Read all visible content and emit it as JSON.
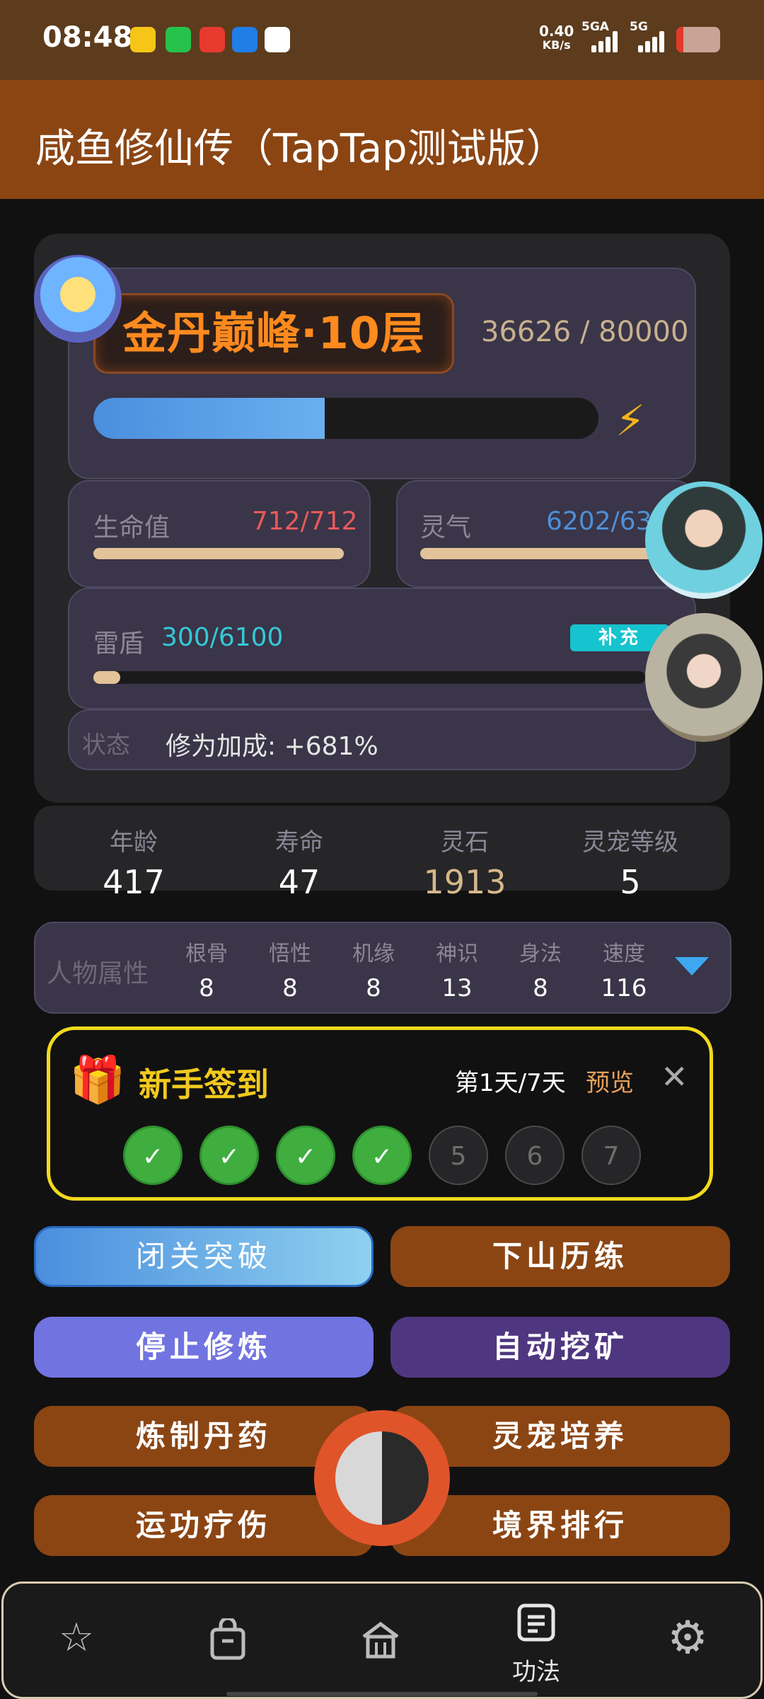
{
  "status_bar": {
    "time": "08:48",
    "net_speed_value": "0.40",
    "net_speed_unit": "KB/s",
    "signal1_label": "5GA",
    "signal2_label": "5G"
  },
  "app_title": "咸鱼修仙传（TapTap测试版）",
  "realm": {
    "name": "金丹巅峰·10层",
    "cultivation_current": "36626",
    "cultivation_max": "80000",
    "cultivation_text": "36626 / 80000",
    "progress_fraction": 0.4578
  },
  "hp": {
    "label": "生命值",
    "value": "712/712",
    "fraction": 1.0
  },
  "spirit": {
    "label": "灵气",
    "value": "6202/63",
    "fraction": 1.0
  },
  "shield": {
    "label": "雷盾",
    "value": "300/6100",
    "refill_label": "补充",
    "fraction": 0.049
  },
  "state": {
    "label": "状态",
    "value": "修为加成: +681%"
  },
  "stats": [
    {
      "label": "年龄",
      "value": "417"
    },
    {
      "label": "寿命",
      "value": "47"
    },
    {
      "label": "灵石",
      "value": "1913"
    },
    {
      "label": "灵宠等级",
      "value": "5"
    }
  ],
  "attributes": {
    "label": "人物属性",
    "items": [
      {
        "label": "根骨",
        "value": "8"
      },
      {
        "label": "悟性",
        "value": "8"
      },
      {
        "label": "机缘",
        "value": "8"
      },
      {
        "label": "神识",
        "value": "13"
      },
      {
        "label": "身法",
        "value": "8"
      },
      {
        "label": "速度",
        "value": "116"
      }
    ]
  },
  "checkin": {
    "title": "新手签到",
    "day_text": "第1天/7天",
    "preview_label": "预览",
    "days": [
      {
        "label": "✓",
        "done": true
      },
      {
        "label": "✓",
        "done": true
      },
      {
        "label": "✓",
        "done": true
      },
      {
        "label": "✓",
        "done": true
      },
      {
        "label": "5",
        "done": false
      },
      {
        "label": "6",
        "done": false
      },
      {
        "label": "7",
        "done": false
      }
    ]
  },
  "actions": {
    "seclusion": "闭关突破",
    "descend": "下山历练",
    "stop_cultivate": "停止修炼",
    "auto_mine": "自动挖矿",
    "alchemy": "炼制丹药",
    "pet_training": "灵宠培养",
    "heal": "运功疗伤",
    "ranking": "境界排行"
  },
  "bottom_nav": {
    "active_label": "功法",
    "icons": [
      "star-icon",
      "bag-icon",
      "home-icon",
      "scroll-icon",
      "gear-icon"
    ]
  },
  "colors": {
    "title_bar": "#8b4513",
    "realm_text": "#ff8a1e",
    "checkin_border": "#f1d91e",
    "shield_value": "#35c8d8",
    "hp_value": "#e85a5a",
    "spirit_value": "#4e8fd6"
  }
}
